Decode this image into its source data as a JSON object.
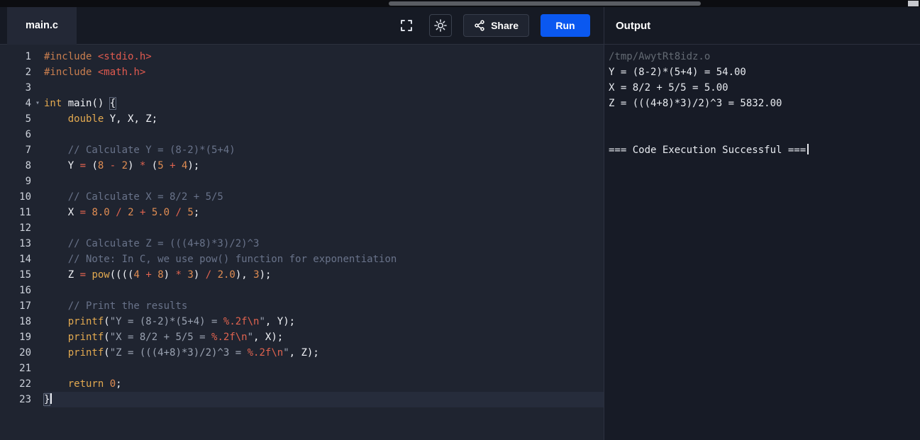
{
  "header": {
    "tab_label": "main.c",
    "share_label": "Share",
    "run_label": "Run",
    "output_title": "Output"
  },
  "icons": {
    "fullscreen": "fullscreen-expand-icon",
    "theme": "sun-brightness-icon",
    "share": "share-nodes-icon",
    "fold": "chevron-down-icon"
  },
  "colors": {
    "run_button": "#0a58f0",
    "editor_background": "#1f2430",
    "output_background": "#171b26",
    "current_line_highlight": "#262c3b"
  },
  "editor": {
    "active_line": 23,
    "lines": [
      {
        "n": 1,
        "tokens": [
          [
            "pre",
            "#include"
          ],
          [
            "pln",
            " "
          ],
          [
            "hdr",
            "<stdio.h>"
          ]
        ]
      },
      {
        "n": 2,
        "tokens": [
          [
            "pre",
            "#include"
          ],
          [
            "pln",
            " "
          ],
          [
            "hdr",
            "<math.h>"
          ]
        ]
      },
      {
        "n": 3,
        "tokens": []
      },
      {
        "n": 4,
        "fold": true,
        "tokens": [
          [
            "kw",
            "int"
          ],
          [
            "pln",
            " main() "
          ],
          [
            "brc",
            "{"
          ]
        ]
      },
      {
        "n": 5,
        "tokens": [
          [
            "pln",
            "    "
          ],
          [
            "kw",
            "double"
          ],
          [
            "pln",
            " Y, X, Z;"
          ]
        ]
      },
      {
        "n": 6,
        "tokens": []
      },
      {
        "n": 7,
        "tokens": [
          [
            "pln",
            "    "
          ],
          [
            "com",
            "// Calculate Y = (8-2)*(5+4)"
          ]
        ]
      },
      {
        "n": 8,
        "tokens": [
          [
            "pln",
            "    Y "
          ],
          [
            "op",
            "="
          ],
          [
            "pln",
            " ("
          ],
          [
            "num",
            "8"
          ],
          [
            "pln",
            " "
          ],
          [
            "op",
            "-"
          ],
          [
            "pln",
            " "
          ],
          [
            "num",
            "2"
          ],
          [
            "pln",
            ") "
          ],
          [
            "op",
            "*"
          ],
          [
            "pln",
            " ("
          ],
          [
            "num",
            "5"
          ],
          [
            "pln",
            " "
          ],
          [
            "op",
            "+"
          ],
          [
            "pln",
            " "
          ],
          [
            "num",
            "4"
          ],
          [
            "pln",
            ");"
          ]
        ]
      },
      {
        "n": 9,
        "tokens": []
      },
      {
        "n": 10,
        "tokens": [
          [
            "pln",
            "    "
          ],
          [
            "com",
            "// Calculate X = 8/2 + 5/5"
          ]
        ]
      },
      {
        "n": 11,
        "tokens": [
          [
            "pln",
            "    X "
          ],
          [
            "op",
            "="
          ],
          [
            "pln",
            " "
          ],
          [
            "num",
            "8.0"
          ],
          [
            "pln",
            " "
          ],
          [
            "op",
            "/"
          ],
          [
            "pln",
            " "
          ],
          [
            "num",
            "2"
          ],
          [
            "pln",
            " "
          ],
          [
            "op",
            "+"
          ],
          [
            "pln",
            " "
          ],
          [
            "num",
            "5.0"
          ],
          [
            "pln",
            " "
          ],
          [
            "op",
            "/"
          ],
          [
            "pln",
            " "
          ],
          [
            "num",
            "5"
          ],
          [
            "pln",
            ";"
          ]
        ]
      },
      {
        "n": 12,
        "tokens": []
      },
      {
        "n": 13,
        "tokens": [
          [
            "pln",
            "    "
          ],
          [
            "com",
            "// Calculate Z = (((4+8)*3)/2)^3"
          ]
        ]
      },
      {
        "n": 14,
        "tokens": [
          [
            "pln",
            "    "
          ],
          [
            "com",
            "// Note: In C, we use pow() function for exponentiation"
          ]
        ]
      },
      {
        "n": 15,
        "tokens": [
          [
            "pln",
            "    Z "
          ],
          [
            "op",
            "="
          ],
          [
            "pln",
            " "
          ],
          [
            "kw",
            "pow"
          ],
          [
            "pln",
            "(((("
          ],
          [
            "num",
            "4"
          ],
          [
            "pln",
            " "
          ],
          [
            "op",
            "+"
          ],
          [
            "pln",
            " "
          ],
          [
            "num",
            "8"
          ],
          [
            "pln",
            ") "
          ],
          [
            "op",
            "*"
          ],
          [
            "pln",
            " "
          ],
          [
            "num",
            "3"
          ],
          [
            "pln",
            ") "
          ],
          [
            "op",
            "/"
          ],
          [
            "pln",
            " "
          ],
          [
            "num",
            "2.0"
          ],
          [
            "pln",
            "), "
          ],
          [
            "num",
            "3"
          ],
          [
            "pln",
            ");"
          ]
        ]
      },
      {
        "n": 16,
        "tokens": []
      },
      {
        "n": 17,
        "tokens": [
          [
            "pln",
            "    "
          ],
          [
            "com",
            "// Print the results"
          ]
        ]
      },
      {
        "n": 18,
        "tokens": [
          [
            "pln",
            "    "
          ],
          [
            "kw",
            "printf"
          ],
          [
            "pln",
            "("
          ],
          [
            "str",
            "\"Y = (8-2)*(5+4) = "
          ],
          [
            "fmt",
            "%.2f\\n"
          ],
          [
            "str",
            "\""
          ],
          [
            "pln",
            ", Y);"
          ]
        ]
      },
      {
        "n": 19,
        "tokens": [
          [
            "pln",
            "    "
          ],
          [
            "kw",
            "printf"
          ],
          [
            "pln",
            "("
          ],
          [
            "str",
            "\"X = 8/2 + 5/5 = "
          ],
          [
            "fmt",
            "%.2f\\n"
          ],
          [
            "str",
            "\""
          ],
          [
            "pln",
            ", X);"
          ]
        ]
      },
      {
        "n": 20,
        "tokens": [
          [
            "pln",
            "    "
          ],
          [
            "kw",
            "printf"
          ],
          [
            "pln",
            "("
          ],
          [
            "str",
            "\"Z = (((4+8)*3)/2)^3 = "
          ],
          [
            "fmt",
            "%.2f\\n"
          ],
          [
            "str",
            "\""
          ],
          [
            "pln",
            ", Z);"
          ]
        ]
      },
      {
        "n": 21,
        "tokens": []
      },
      {
        "n": 22,
        "tokens": [
          [
            "pln",
            "    "
          ],
          [
            "kw",
            "return"
          ],
          [
            "pln",
            " "
          ],
          [
            "num",
            "0"
          ],
          [
            "pln",
            ";"
          ]
        ]
      },
      {
        "n": 23,
        "current": true,
        "cursor": true,
        "tokens": [
          [
            "brc",
            "}"
          ]
        ]
      }
    ]
  },
  "output": {
    "lines": [
      {
        "text": "/tmp/AwytRt8idz.o",
        "muted": true
      },
      {
        "text": "Y = (8-2)*(5+4) = 54.00"
      },
      {
        "text": "X = 8/2 + 5/5 = 5.00"
      },
      {
        "text": "Z = (((4+8)*3)/2)^3 = 5832.00"
      },
      {
        "text": ""
      },
      {
        "text": ""
      },
      {
        "text": "=== Code Execution Successful ===",
        "cursor": true
      }
    ]
  }
}
